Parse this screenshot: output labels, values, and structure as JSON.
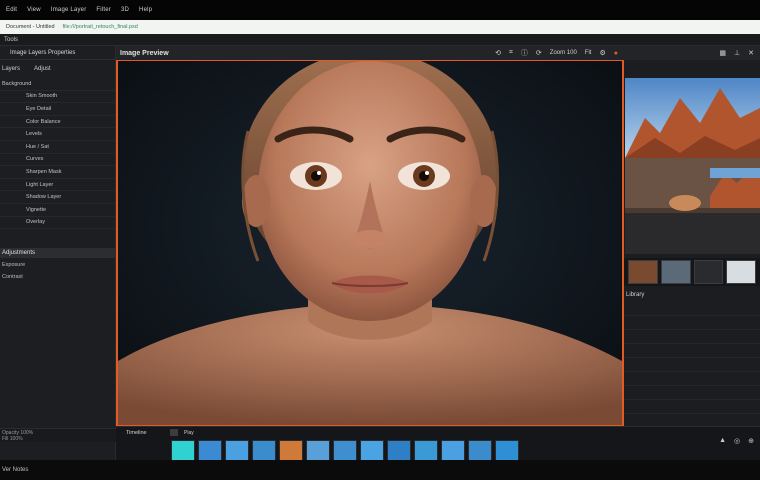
{
  "menu": {
    "items": [
      "Edit",
      "View",
      "Image Layer",
      "Filter",
      "3D",
      "Help"
    ]
  },
  "address": {
    "text": "Document - Untitled",
    "url": "file:///portrait_retouch_final.psd"
  },
  "toolbar_strip": {
    "label": "Tools"
  },
  "sidebar": {
    "header": "Image Layers Properties",
    "subtabs": [
      "Layers",
      "Adjust"
    ],
    "rows": [
      "Background",
      "Skin Smooth",
      "Eye Detail",
      "Color Balance",
      "Levels",
      "Hue / Sat",
      "Curves",
      "Sharpen Mask",
      "Light Layer",
      "Shadow Layer",
      "Vignette",
      "Overlay"
    ],
    "section_title": "Adjustments",
    "line1": "Exposure",
    "line2": "Contrast",
    "bottom1": "Opacity 100%",
    "bottom2": "Fill 100%"
  },
  "canvas": {
    "title": "Image Preview",
    "tools_label1": "Zoom 100",
    "tools_label2": "Fit",
    "colors": {
      "frame": "#e35a23",
      "skin": "#c78a6a",
      "hair": "#8a5a3a",
      "bg": "#0e1216"
    }
  },
  "right_panel": {
    "icons": [
      "grid-icon",
      "pin-icon",
      "close-icon"
    ],
    "label": "Library",
    "colors": {
      "sky": "#6fa3d6",
      "rock": "#b0552d",
      "sand": "#c88a5a"
    }
  },
  "filmstrip": {
    "label": "Timeline",
    "label2": "Play",
    "frame_colors": [
      "#2fd1d1",
      "#3b8ad4",
      "#4aa0e0",
      "#3a8ccc",
      "#d07a3a",
      "#5aa0d8",
      "#3f8ed0",
      "#4aa3e3",
      "#2f7fc7",
      "#3b9ad6",
      "#4aa0e0",
      "#3a8ccc",
      "#2f8fd4"
    ]
  },
  "status": {
    "text": "Ver Notes"
  }
}
